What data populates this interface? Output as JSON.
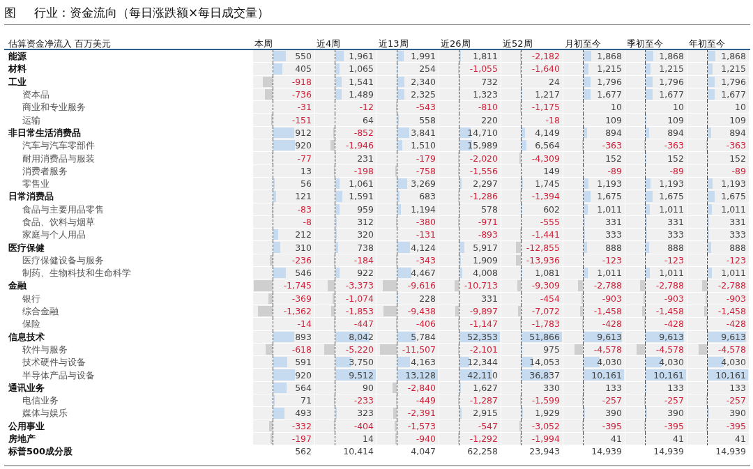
{
  "figure": {
    "label": "图",
    "title": "行业：资金流向（每日涨跌额×每日成交量）"
  },
  "header": {
    "caption": "估算资金净流入 百万美元",
    "columns": [
      "本周",
      "近4周",
      "近13周",
      "近26周",
      "近52周",
      "月初至今",
      "季初至今",
      "年初至今"
    ]
  },
  "sectors": [
    {
      "name": "能源",
      "values": [
        "550",
        "1,961",
        "1,991",
        "1,811",
        "-2,182",
        "1,868",
        "1,868",
        "1,868"
      ]
    },
    {
      "name": "材料",
      "values": [
        "405",
        "1,065",
        "254",
        "-1,055",
        "-1,640",
        "1,215",
        "1,215",
        "1,215"
      ]
    },
    {
      "name": "工业",
      "values": [
        "-918",
        "1,541",
        "2,340",
        "732",
        "24",
        "1,796",
        "1,796",
        "1,796"
      ],
      "children": [
        {
          "name": "资本品",
          "values": [
            "-736",
            "1,489",
            "2,325",
            "1,323",
            "1,217",
            "1,677",
            "1,677",
            "1,677"
          ]
        },
        {
          "name": "商业和专业服务",
          "values": [
            "-31",
            "-12",
            "-543",
            "-810",
            "-1,175",
            "10",
            "10",
            "10"
          ]
        },
        {
          "name": "运输",
          "values": [
            "-151",
            "64",
            "558",
            "220",
            "-18",
            "109",
            "109",
            "109"
          ]
        }
      ]
    },
    {
      "name": "非日常生活消费品",
      "values": [
        "912",
        "-852",
        "3,841",
        "14,710",
        "4,149",
        "894",
        "894",
        "894"
      ],
      "children": [
        {
          "name": "汽车与汽车零部件",
          "values": [
            "920",
            "-1,946",
            "1,510",
            "15,989",
            "6,564",
            "-363",
            "-363",
            "-363"
          ]
        },
        {
          "name": "耐用消费品与服装",
          "values": [
            "-77",
            "231",
            "-179",
            "-2,020",
            "-4,309",
            "152",
            "152",
            "152"
          ]
        },
        {
          "name": "消费者服务",
          "values": [
            "13",
            "-198",
            "-758",
            "-1,556",
            "149",
            "-89",
            "-89",
            "-89"
          ]
        },
        {
          "name": "零售业",
          "values": [
            "56",
            "1,061",
            "3,269",
            "2,297",
            "1,745",
            "1,193",
            "1,193",
            "1,193"
          ]
        }
      ]
    },
    {
      "name": "日常消费品",
      "values": [
        "121",
        "1,591",
        "683",
        "-1,286",
        "-1,394",
        "1,675",
        "1,675",
        "1,675"
      ],
      "children": [
        {
          "name": "食品与主要用品零售",
          "values": [
            "-83",
            "959",
            "1,194",
            "578",
            "602",
            "1,011",
            "1,011",
            "1,011"
          ]
        },
        {
          "name": "食品、饮料与烟草",
          "values": [
            "-8",
            "312",
            "-380",
            "-971",
            "-555",
            "331",
            "331",
            "331"
          ]
        },
        {
          "name": "家庭与个人用品",
          "values": [
            "212",
            "320",
            "-131",
            "-893",
            "-1,441",
            "333",
            "333",
            "333"
          ]
        }
      ]
    },
    {
      "name": "医疗保健",
      "values": [
        "310",
        "738",
        "4,124",
        "5,917",
        "-12,855",
        "888",
        "888",
        "888"
      ],
      "children": [
        {
          "name": "医疗保健设备与服务",
          "values": [
            "-236",
            "-184",
            "-343",
            "1,909",
            "-13,936",
            "-123",
            "-123",
            "-123"
          ]
        },
        {
          "name": "制药、生物科技和生命科学",
          "values": [
            "546",
            "922",
            "4,467",
            "4,008",
            "1,081",
            "1,011",
            "1,011",
            "1,011"
          ]
        }
      ]
    },
    {
      "name": "金融",
      "values": [
        "-1,745",
        "-3,373",
        "-9,616",
        "-10,713",
        "-9,309",
        "-2,788",
        "-2,788",
        "-2,788"
      ],
      "children": [
        {
          "name": "银行",
          "values": [
            "-369",
            "-1,074",
            "228",
            "331",
            "-454",
            "-903",
            "-903",
            "-903"
          ]
        },
        {
          "name": "综合金融",
          "values": [
            "-1,362",
            "-1,853",
            "-9,438",
            "-9,897",
            "-7,072",
            "-1,458",
            "-1,458",
            "-1,458"
          ]
        },
        {
          "name": "保险",
          "values": [
            "-14",
            "-447",
            "-406",
            "-1,147",
            "-1,783",
            "-428",
            "-428",
            "-428"
          ]
        }
      ]
    },
    {
      "name": "信息技术",
      "values": [
        "893",
        "8,042",
        "5,784",
        "52,353",
        "51,866",
        "9,613",
        "9,613",
        "9,613"
      ],
      "children": [
        {
          "name": "软件与服务",
          "values": [
            "-618",
            "-5,220",
            "-11,507",
            "-2,101",
            "975",
            "-4,578",
            "-4,578",
            "-4,578"
          ]
        },
        {
          "name": "技术硬件与设备",
          "values": [
            "591",
            "3,750",
            "4,163",
            "12,344",
            "14,053",
            "4,030",
            "4,030",
            "4,030"
          ]
        },
        {
          "name": "半导体产品与设备",
          "values": [
            "920",
            "9,512",
            "13,128",
            "42,110",
            "36,837",
            "10,161",
            "10,161",
            "10,161"
          ]
        }
      ]
    },
    {
      "name": "通讯业务",
      "values": [
        "564",
        "90",
        "-2,840",
        "1,627",
        "330",
        "133",
        "133",
        "133"
      ],
      "children": [
        {
          "name": "电信业务",
          "values": [
            "71",
            "-233",
            "-449",
            "-1,287",
            "-1,599",
            "-257",
            "-257",
            "-257"
          ]
        },
        {
          "name": "媒体与娱乐",
          "values": [
            "493",
            "323",
            "-2,391",
            "2,915",
            "1,929",
            "390",
            "390",
            "390"
          ]
        }
      ]
    },
    {
      "name": "公用事业",
      "values": [
        "-332",
        "-404",
        "-1,573",
        "-547",
        "-3,052",
        "-395",
        "-395",
        "-395"
      ]
    },
    {
      "name": "房地产",
      "values": [
        "-197",
        "14",
        "-940",
        "-1,292",
        "-1,994",
        "41",
        "41",
        "41"
      ]
    }
  ],
  "total": {
    "name": "标普500成分股",
    "values": [
      "562",
      "10,414",
      "4,047",
      "62,258",
      "23,943",
      "14,939",
      "14,939",
      "14,939"
    ]
  }
}
